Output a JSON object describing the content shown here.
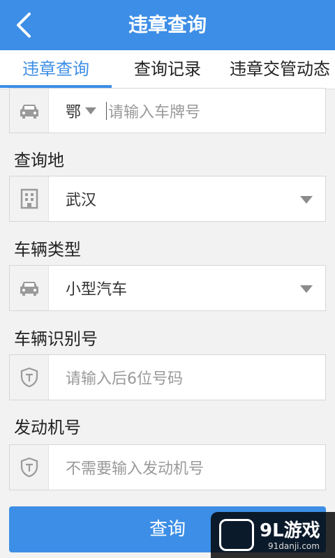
{
  "header": {
    "title": "违章查询"
  },
  "tabs": [
    {
      "label": "违章查询",
      "active": true
    },
    {
      "label": "查询记录",
      "active": false
    },
    {
      "label": "违章交管动态",
      "active": false
    }
  ],
  "plate": {
    "province": "鄂",
    "placeholder": "请输入车牌号"
  },
  "city": {
    "label": "查询地",
    "value": "武汉"
  },
  "vehicle_type": {
    "label": "车辆类型",
    "value": "小型汽车"
  },
  "vin": {
    "label": "车辆识别号",
    "placeholder": "请输入后6位号码"
  },
  "engine": {
    "label": "发动机号",
    "placeholder": "不需要输入发动机号"
  },
  "submit": {
    "label": "查询"
  },
  "watermark": {
    "main": "9L游戏",
    "sub": "91danji.com"
  },
  "colors": {
    "primary": "#3d8ee6",
    "background": "#f2f2f2",
    "icon": "#8c8c8c"
  }
}
